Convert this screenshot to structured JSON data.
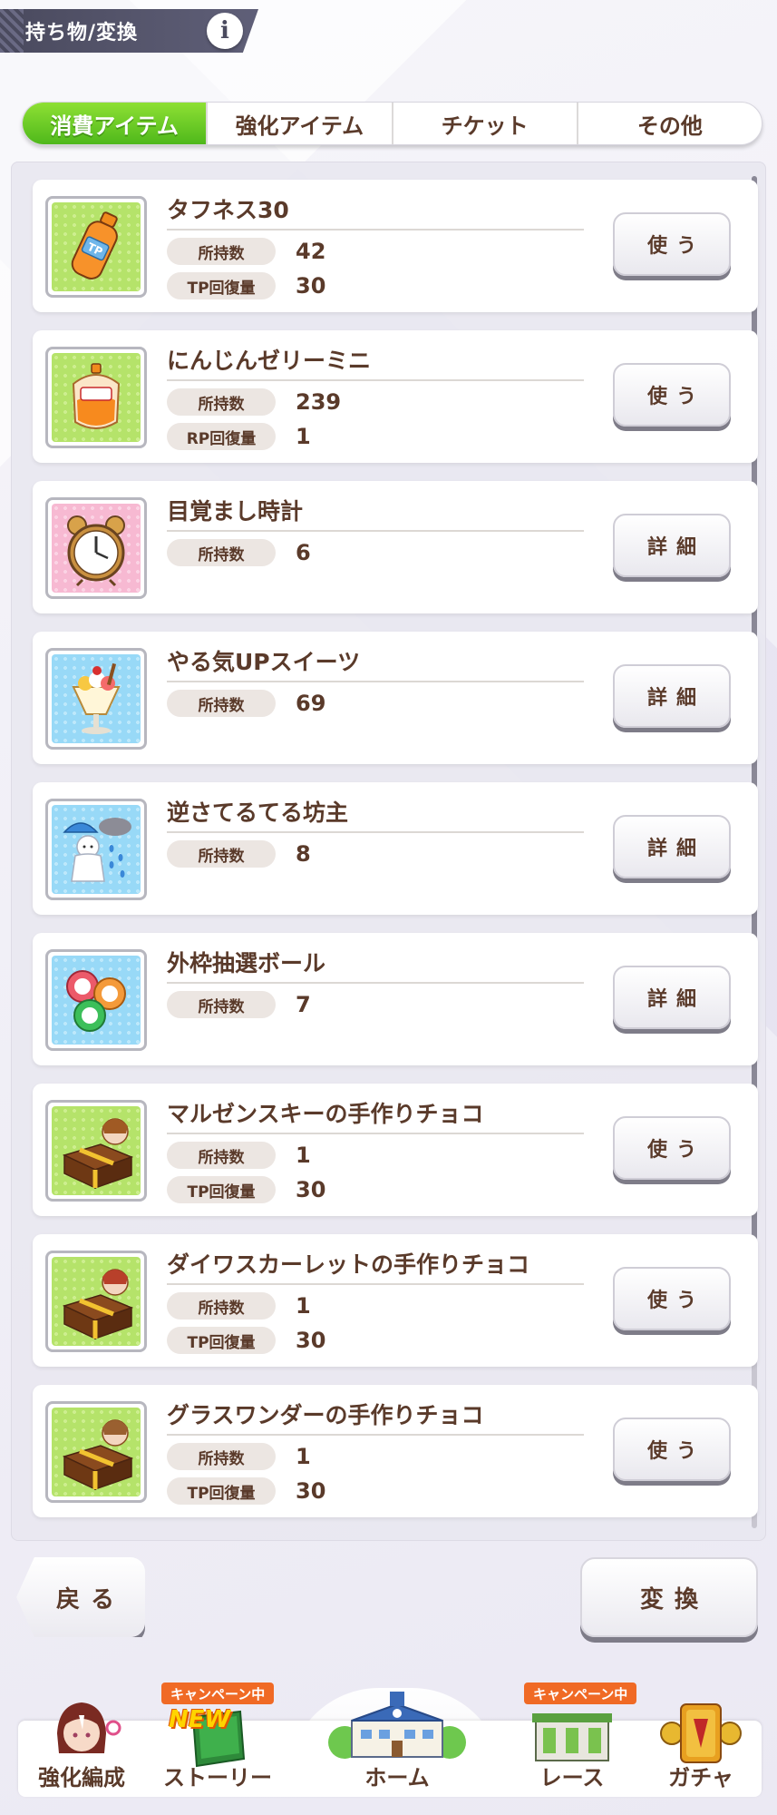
{
  "header": {
    "title": "持ち物/変換",
    "info_label": "i"
  },
  "tabs": [
    {
      "label": "消費アイテム",
      "active": true
    },
    {
      "label": "強化アイテム",
      "active": false
    },
    {
      "label": "チケット",
      "active": false
    },
    {
      "label": "その他",
      "active": false
    }
  ],
  "items": [
    {
      "name": "タフネス30",
      "icon": "tp-bottle-icon",
      "bg": "green",
      "stats": [
        {
          "label": "所持数",
          "value": "42"
        },
        {
          "label": "TP回復量",
          "value": "30"
        }
      ],
      "button": "使う"
    },
    {
      "name": "にんじんゼリーミニ",
      "icon": "carrot-jelly-icon",
      "bg": "green",
      "stats": [
        {
          "label": "所持数",
          "value": "239"
        },
        {
          "label": "RP回復量",
          "value": "1"
        }
      ],
      "button": "使う"
    },
    {
      "name": "目覚まし時計",
      "icon": "alarm-clock-icon",
      "bg": "pink",
      "stats": [
        {
          "label": "所持数",
          "value": "6"
        }
      ],
      "button": "詳細"
    },
    {
      "name": "やる気UPスイーツ",
      "icon": "parfait-icon",
      "bg": "blue",
      "stats": [
        {
          "label": "所持数",
          "value": "69"
        }
      ],
      "button": "詳細"
    },
    {
      "name": "逆さてるてる坊主",
      "icon": "teru-teru-bozu-icon",
      "bg": "blue",
      "stats": [
        {
          "label": "所持数",
          "value": "8"
        }
      ],
      "button": "詳細"
    },
    {
      "name": "外枠抽選ボール",
      "icon": "lottery-balls-icon",
      "bg": "blue",
      "stats": [
        {
          "label": "所持数",
          "value": "7"
        }
      ],
      "button": "詳細"
    },
    {
      "name": "マルゼンスキーの手作りチョコ",
      "icon": "gift-box-icon",
      "bg": "green",
      "stats": [
        {
          "label": "所持数",
          "value": "1"
        },
        {
          "label": "TP回復量",
          "value": "30"
        }
      ],
      "button": "使う"
    },
    {
      "name": "ダイワスカーレットの手作りチョコ",
      "icon": "gift-box-icon",
      "bg": "green",
      "stats": [
        {
          "label": "所持数",
          "value": "1"
        },
        {
          "label": "TP回復量",
          "value": "30"
        }
      ],
      "button": "使う"
    },
    {
      "name": "グラスワンダーの手作りチョコ",
      "icon": "gift-box-icon",
      "bg": "green",
      "stats": [
        {
          "label": "所持数",
          "value": "1"
        },
        {
          "label": "TP回復量",
          "value": "30"
        }
      ],
      "button": "使う"
    }
  ],
  "buttons": {
    "back": "戻る",
    "convert": "変換"
  },
  "nav": {
    "items": [
      {
        "label": "強化編成",
        "icon": "character-icon"
      },
      {
        "label": "ストーリー",
        "icon": "story-book-icon",
        "badge": "キャンペーン中",
        "new": "NEW"
      },
      {
        "label": "ホーム",
        "icon": "school-building-icon"
      },
      {
        "label": "レース",
        "icon": "race-gate-icon",
        "badge": "キャンペーン中"
      },
      {
        "label": "ガチャ",
        "icon": "gacha-gate-icon"
      }
    ]
  },
  "colors": {
    "tab_active": "#4fb81b",
    "text_brown": "#5a3a2a",
    "header_bg": "#4a4a5e",
    "campaign_badge": "#f06a25",
    "new_badge": "#ffd400"
  }
}
